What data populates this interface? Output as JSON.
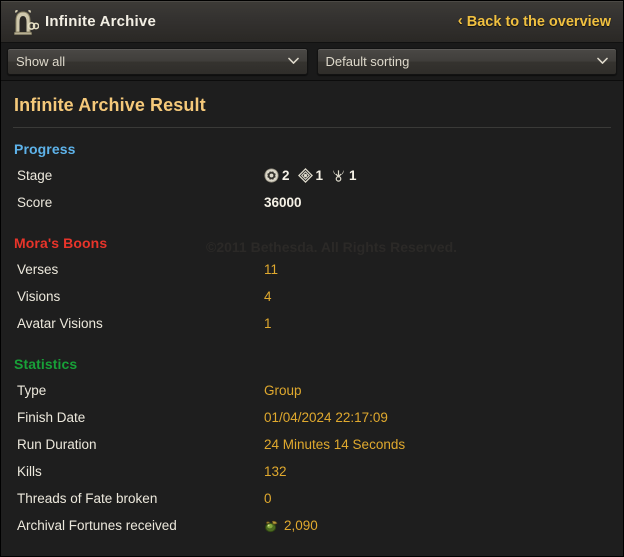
{
  "header": {
    "logo_icon": "infinite-archive-portal-icon",
    "title": "Infinite Archive",
    "back_label": "Back to the overview",
    "back_chevron": "‹"
  },
  "filters": {
    "show_filter": {
      "value": "Show all",
      "caret": "⌄"
    },
    "sort_filter": {
      "value": "Default sorting",
      "caret": "⌄"
    }
  },
  "watermark": "©2011 Bethesda. All Rights Reserved.",
  "page": {
    "title": "Infinite Archive Result"
  },
  "sections": [
    {
      "id": "progress",
      "heading": "Progress",
      "color": "#5eb3ea",
      "rows": [
        {
          "label": "Stage",
          "type": "stage"
        },
        {
          "label": "Score",
          "value": "36000",
          "style": "plain"
        }
      ]
    },
    {
      "id": "moras-boons",
      "heading": "Mora's Boons",
      "color": "#e8342a",
      "rows": [
        {
          "label": "Verses",
          "value": "11"
        },
        {
          "label": "Visions",
          "value": "4"
        },
        {
          "label": "Avatar Visions",
          "value": "1"
        }
      ]
    },
    {
      "id": "statistics",
      "heading": "Statistics",
      "color": "#18a038",
      "rows": [
        {
          "label": "Type",
          "value": "Group"
        },
        {
          "label": "Finish Date",
          "value": "01/04/2024 22:17:09"
        },
        {
          "label": "Run Duration",
          "value": "24 Minutes 14 Seconds"
        },
        {
          "label": "Kills",
          "value": "132"
        },
        {
          "label": "Threads of Fate broken",
          "value": "0"
        },
        {
          "label": "Archival Fortunes received",
          "value": "2,090",
          "icon": "archival-fortune-coin-icon"
        }
      ]
    }
  ],
  "stage": {
    "pips": [
      {
        "icon": "stage-medallion-icon",
        "count": "2"
      },
      {
        "icon": "stage-diamond-icon",
        "count": "1"
      },
      {
        "icon": "stage-trident-icon",
        "count": "1"
      }
    ]
  }
}
